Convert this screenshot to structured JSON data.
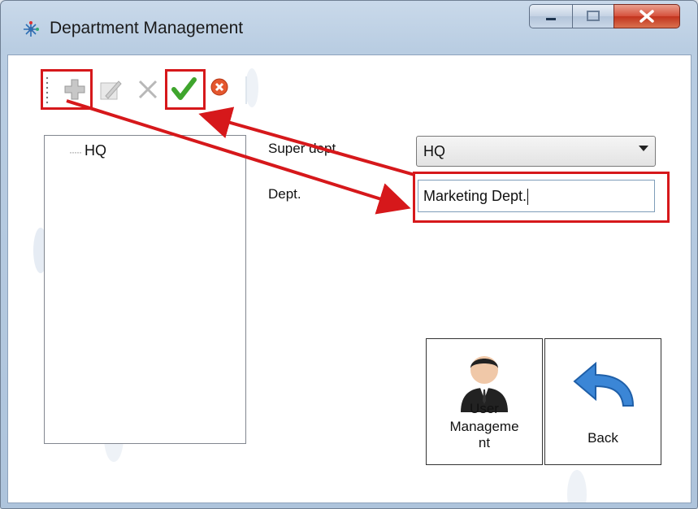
{
  "window": {
    "title": "Department Management"
  },
  "caption_buttons": {
    "minimize": "minimize-icon",
    "maximize": "maximize-icon",
    "close": "close-icon"
  },
  "toolbar": {
    "items": [
      {
        "icon": "add-icon",
        "enabled": true,
        "highlighted": true
      },
      {
        "icon": "edit-icon",
        "enabled": false,
        "highlighted": false
      },
      {
        "icon": "delete-icon",
        "enabled": false,
        "highlighted": false
      },
      {
        "icon": "save-checkmark-icon",
        "enabled": true,
        "highlighted": true
      },
      {
        "icon": "cancel-icon",
        "enabled": true,
        "highlighted": false
      }
    ]
  },
  "tree": {
    "nodes": [
      {
        "label": "HQ"
      }
    ]
  },
  "form": {
    "super_dept_label": "Super dept.",
    "super_dept_value": "HQ",
    "dept_label": "Dept.",
    "dept_value": "Marketing Dept."
  },
  "buttons": {
    "user_management_label_line1": "User",
    "user_management_label_line2": "Manageme",
    "user_management_label_line3": "nt",
    "back_label": "Back"
  },
  "colors": {
    "highlight": "#d6181b",
    "title_bg": "#c9d9ea",
    "back_arrow": "#3b86d6"
  }
}
